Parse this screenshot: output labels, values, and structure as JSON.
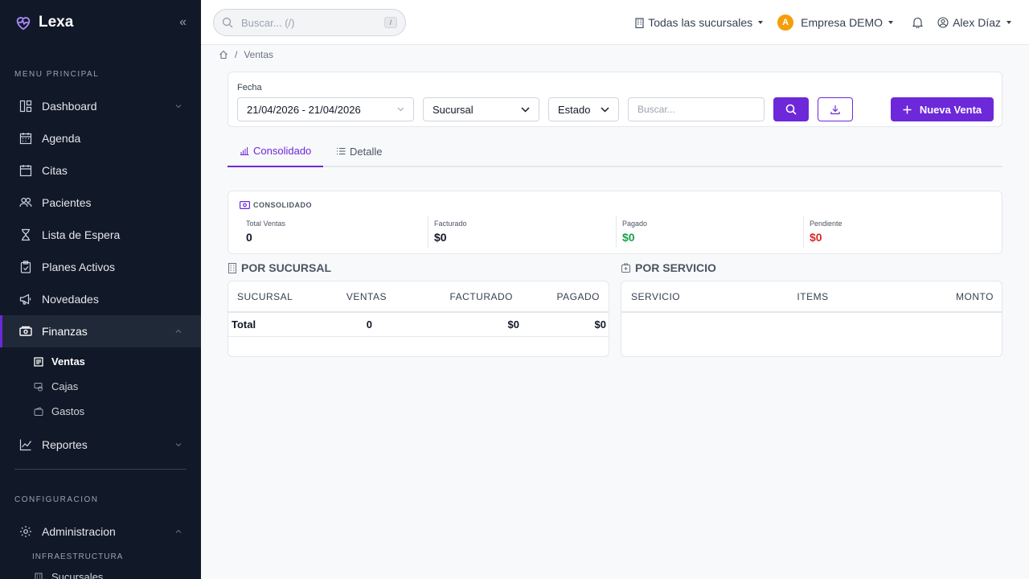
{
  "app": {
    "name": "Lexa"
  },
  "sidebar": {
    "main_label": "MENU PRINCIPAL",
    "items": [
      {
        "label": "Dashboard",
        "icon": "dashboard-icon"
      },
      {
        "label": "Agenda",
        "icon": "calendar-icon"
      },
      {
        "label": "Citas",
        "icon": "calendar-check-icon"
      },
      {
        "label": "Pacientes",
        "icon": "users-icon"
      },
      {
        "label": "Lista de Espera",
        "icon": "hourglass-icon"
      },
      {
        "label": "Planes Activos",
        "icon": "clipboard-icon"
      },
      {
        "label": "Novedades",
        "icon": "megaphone-icon"
      },
      {
        "label": "Finanzas",
        "icon": "cash-icon"
      }
    ],
    "finanzas_sub": [
      {
        "label": "Ventas",
        "icon": "receipt-icon"
      },
      {
        "label": "Cajas",
        "icon": "coins-icon"
      },
      {
        "label": "Gastos",
        "icon": "wallet-icon"
      }
    ],
    "reportes": {
      "label": "Reportes",
      "icon": "chart-line-icon"
    },
    "config_label": "CONFIGURACION",
    "admin": {
      "label": "Administracion",
      "icon": "gear-icon"
    },
    "infra_label": "INFRAESTRUCTURA",
    "infra_sub": [
      {
        "label": "Sucursales",
        "icon": "building-icon"
      }
    ]
  },
  "topbar": {
    "search_placeholder": "Buscar... (/)",
    "search_kbd": "/",
    "branches": "Todas las sucursales",
    "company_initial": "A",
    "company": "Empresa DEMO",
    "user": "Alex Díaz"
  },
  "breadcrumb": {
    "current": "Ventas"
  },
  "filters": {
    "date_label": "Fecha",
    "date_value": "21/04/2026 - 21/04/2026",
    "branch": "Sucursal",
    "status": "Estado",
    "search_placeholder": "Buscar...",
    "new_button": "Nueva Venta"
  },
  "tabs": [
    {
      "label": "Consolidado",
      "active": true
    },
    {
      "label": "Detalle",
      "active": false
    }
  ],
  "consolidado": {
    "title": "CONSOLIDADO",
    "metrics": [
      {
        "label": "Total Ventas",
        "value": "0",
        "color": "#111827"
      },
      {
        "label": "Facturado",
        "value": "$0",
        "color": "#111827"
      },
      {
        "label": "Pagado",
        "value": "$0",
        "color": "#16a34a"
      },
      {
        "label": "Pendiente",
        "value": "$0",
        "color": "#dc2626"
      }
    ]
  },
  "por_sucursal": {
    "title": "POR SUCURSAL",
    "headers": [
      "SUCURSAL",
      "VENTAS",
      "FACTURADO",
      "PAGADO"
    ],
    "total_row": [
      "Total",
      "0",
      "$0",
      "$0"
    ]
  },
  "por_servicio": {
    "title": "POR SERVICIO",
    "headers": [
      "SERVICIO",
      "ITEMS",
      "MONTO"
    ]
  },
  "colors": {
    "accent": "#6d28d9",
    "sidebar_bg": "#111827"
  }
}
